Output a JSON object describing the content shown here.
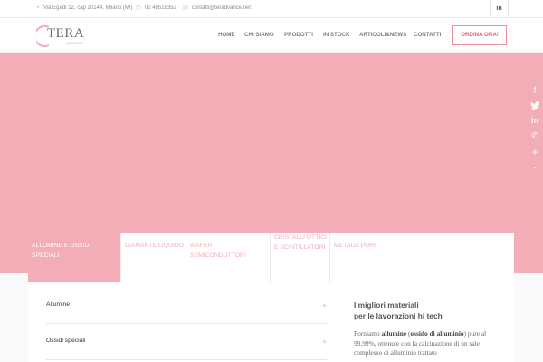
{
  "topbar": {
    "address": "Via Egadi 12, cap 20144, Milano (MI)",
    "phone": "02 48518352",
    "email": "contatti@teradvance.net",
    "social_label": "in"
  },
  "logo": {
    "name": "TERA",
    "sub": "ADVANCE"
  },
  "nav": {
    "items": [
      "HOME",
      "CHI SIAMO",
      "PRODOTTI",
      "IN STOCK",
      "ARTICOLI&NEWS",
      "CONTATTI"
    ],
    "cta": "ORDINA ORA!"
  },
  "share": [
    "f",
    "🐦",
    "in",
    "✆",
    "+"
  ],
  "tabs": [
    {
      "label": "ALLUMINE E OSSIDI SPECIALI"
    },
    {
      "label": "DIAMANTE LIQUIDO"
    },
    {
      "label": "WAFER SEMICONDUTTORI"
    },
    {
      "label_line1": "CRISTALLI OTTICI",
      "label_line2": "E SCINTILLATORI"
    },
    {
      "label": "METALLI PURI"
    }
  ],
  "accordion": [
    {
      "label": "Allumine",
      "icon": "+"
    },
    {
      "label": "Ossidi speciali",
      "icon": "+"
    }
  ],
  "intro": {
    "title_line1": "I migliori materiali",
    "title_line2": "per le lavorazioni hi tech",
    "para_start": "Forniamo ",
    "para_bold1": "allumine",
    "para_mid1": " (",
    "para_bold2": "ossido di alluminio",
    "para_mid2": ") pure al 99.99%, ottenute con la calcinazione di un sale complesso di alluminio trattato"
  }
}
